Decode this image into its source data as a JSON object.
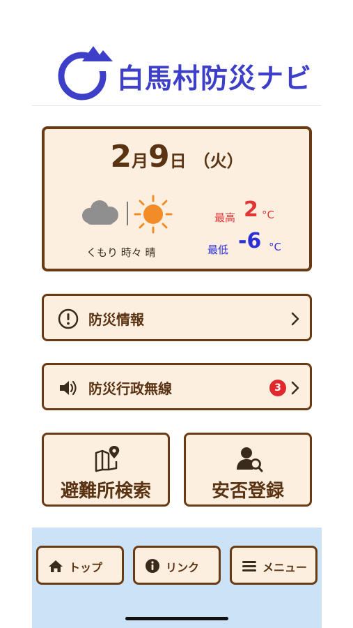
{
  "header": {
    "logo_text": "白馬村防災ナビ",
    "logo_icon": "circle-arrow-mountain-logo"
  },
  "weather": {
    "month": "2",
    "month_unit": "月",
    "day": "9",
    "day_unit": "日",
    "weekday": "（火）",
    "condition_icons": [
      "cloud-icon",
      "sun-icon"
    ],
    "condition": "くもり 時々 晴",
    "high_label": "最高",
    "high_value": "2",
    "low_label": "最低",
    "low_value": "-6",
    "unit": "°C",
    "colors": {
      "high": "#e03636",
      "low": "#2b2fd6"
    }
  },
  "menu": {
    "disaster_info": {
      "label": "防災情報",
      "icon": "exclamation-circle-icon"
    },
    "radio": {
      "label": "防災行政無線",
      "icon": "speaker-icon",
      "badge": "3"
    },
    "shelter": {
      "label": "避難所検索",
      "icon": "map-pin-icon"
    },
    "safety": {
      "label": "安否登録",
      "icon": "user-search-icon"
    }
  },
  "footer": {
    "tabs": [
      {
        "label": "トップ",
        "icon": "home-icon"
      },
      {
        "label": "リンク",
        "icon": "info-icon"
      },
      {
        "label": "メニュー",
        "icon": "hamburger-icon"
      }
    ]
  },
  "colors": {
    "brand": "#3d3fc9",
    "card_bg": "#fcefe0",
    "border": "#6a3a14",
    "footer_bg": "#cce2f6",
    "badge": "#e0282d"
  }
}
